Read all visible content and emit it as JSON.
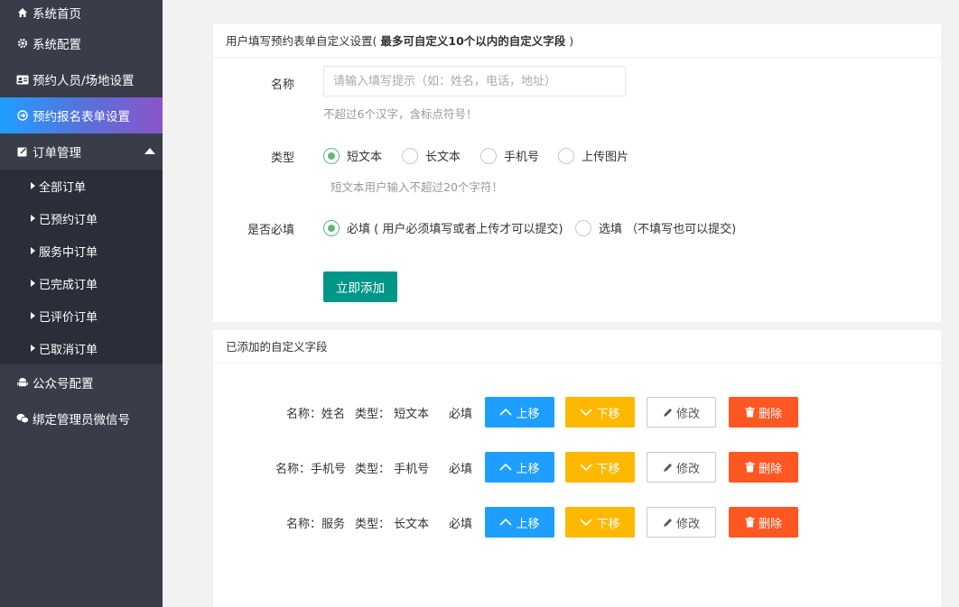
{
  "sidebar": {
    "items": [
      {
        "label": "系统首页",
        "icon": "home-icon"
      },
      {
        "label": "系统配置",
        "icon": "gear-icon"
      },
      {
        "label": "预约人员/场地设置",
        "icon": "id-card-icon"
      },
      {
        "label": "预约报名表单设置",
        "icon": "circle-arrow-icon"
      },
      {
        "label": "订单管理",
        "icon": "edit-icon"
      }
    ],
    "subitems": [
      "全部订单",
      "已预约订单",
      "服务中订单",
      "已完成订单",
      "已评价订单",
      "已取消订单"
    ],
    "bottom_items": [
      {
        "label": "公众号配置",
        "icon": "android-icon"
      },
      {
        "label": "绑定管理员微信号",
        "icon": "wechat-icon"
      }
    ]
  },
  "form_card": {
    "title_prefix": "用户填写预约表单自定义设置(",
    "title_bold": "最多可自定义10个以内的自定义字段",
    "title_suffix": ")",
    "name_label": "名称",
    "name_placeholder": "请输入填写提示（如：姓名，电话，地址）",
    "name_hint": "不超过6个汉字，含标点符号！",
    "type_label": "类型",
    "type_options": [
      "短文本",
      "长文本",
      "手机号",
      "上传图片"
    ],
    "type_hint": "短文本用户输入不超过20个字符！",
    "required_label": "是否必填",
    "required_option": "必填 ( 用户必须填写或者上传才可以提交)",
    "optional_option": "选填 （不填写也可以提交)",
    "add_button": "立即添加"
  },
  "list_card": {
    "title": "已添加的自定义字段",
    "rows": [
      {
        "name": "名称：姓名",
        "type": "类型：  短文本",
        "required": "必填"
      },
      {
        "name": "名称：手机号",
        "type": "类型：  手机号",
        "required": "必填"
      },
      {
        "name": "名称：服务",
        "type": "类型：  长文本",
        "required": "必填"
      }
    ],
    "buttons": {
      "up": "上移",
      "down": "下移",
      "edit": "修改",
      "delete": "删除"
    }
  },
  "colors": {
    "sidebar_bg": "#393d49",
    "primary_green": "#009688",
    "blue": "#1e9fff",
    "yellow": "#ffb800",
    "orange": "#ff5722",
    "radio_green": "#5fb878"
  }
}
